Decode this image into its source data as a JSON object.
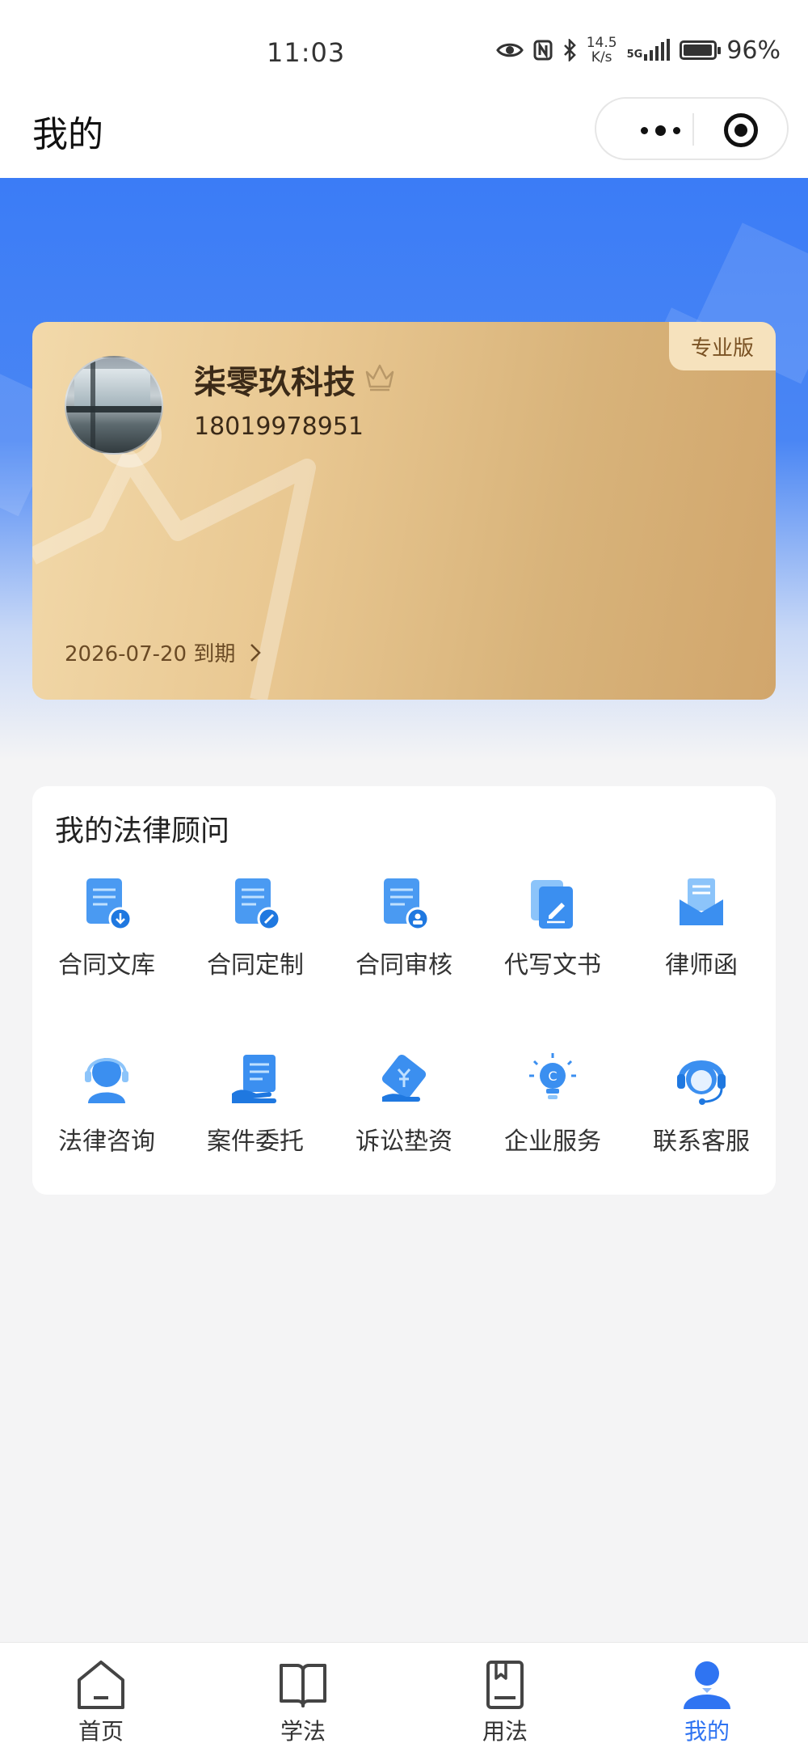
{
  "status_bar": {
    "time": "11:03",
    "net_speed_value": "14.5",
    "net_speed_unit": "K/s",
    "network_type": "5G",
    "battery_level": 0.96,
    "battery_text": "96%"
  },
  "nav": {
    "title": "我的"
  },
  "member_card": {
    "edition": "专业版",
    "company_name": "柒零玖科技",
    "phone": "18019978951",
    "expiry": "2026-07-20 到期"
  },
  "services": {
    "title": "我的法律顾问",
    "items": [
      {
        "label": "合同文库",
        "icon": "contract-library-icon"
      },
      {
        "label": "合同定制",
        "icon": "contract-custom-icon"
      },
      {
        "label": "合同审核",
        "icon": "contract-review-icon"
      },
      {
        "label": "代写文书",
        "icon": "document-drafting-icon"
      },
      {
        "label": "律师函",
        "icon": "lawyer-letter-icon"
      },
      {
        "label": "法律咨询",
        "icon": "legal-consult-icon"
      },
      {
        "label": "案件委托",
        "icon": "case-entrust-icon"
      },
      {
        "label": "诉讼垫资",
        "icon": "litigation-funding-icon"
      },
      {
        "label": "企业服务",
        "icon": "enterprise-service-icon"
      },
      {
        "label": "联系客服",
        "icon": "customer-service-icon"
      }
    ]
  },
  "tab_bar": {
    "tabs": [
      {
        "label": "首页",
        "icon": "home-icon",
        "active": false
      },
      {
        "label": "学法",
        "icon": "book-open-icon",
        "active": false
      },
      {
        "label": "用法",
        "icon": "handbook-icon",
        "active": false
      },
      {
        "label": "我的",
        "icon": "user-icon",
        "active": true
      }
    ]
  },
  "colors": {
    "primary": "#2f74f2",
    "icon_blue": "#3b8ff0",
    "gold_card": "#e3c085",
    "gold_text": "#3b2a18"
  }
}
